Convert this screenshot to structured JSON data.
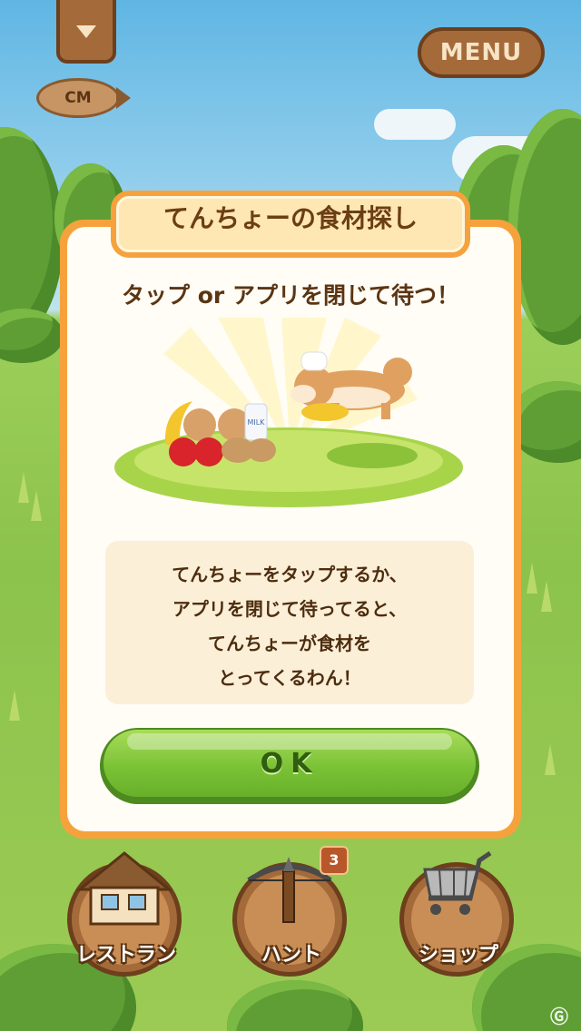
{
  "hud": {
    "dropdown_icon": "triangle-down-icon",
    "menu_label": "MENU",
    "cm_label": "CM"
  },
  "dialog": {
    "title": "てんちょーの食材探し",
    "subtitle": "タップ or アプリを閉じて待つ！",
    "illustration_milk_label": "MILK",
    "message_lines": [
      "てんちょーをタップするか、",
      "アプリを閉じて待ってると、",
      "てんちょーが食材を",
      "とってくるわん！"
    ],
    "ok_label": "OK"
  },
  "nav": {
    "restaurant_label": "レストラン",
    "hunt_label": "ハント",
    "hunt_badge": "3",
    "shop_label": "ショップ"
  },
  "colors": {
    "dialog_border": "#f6a23c",
    "ok_green": "#78c034",
    "wood": "#a56a3a"
  }
}
